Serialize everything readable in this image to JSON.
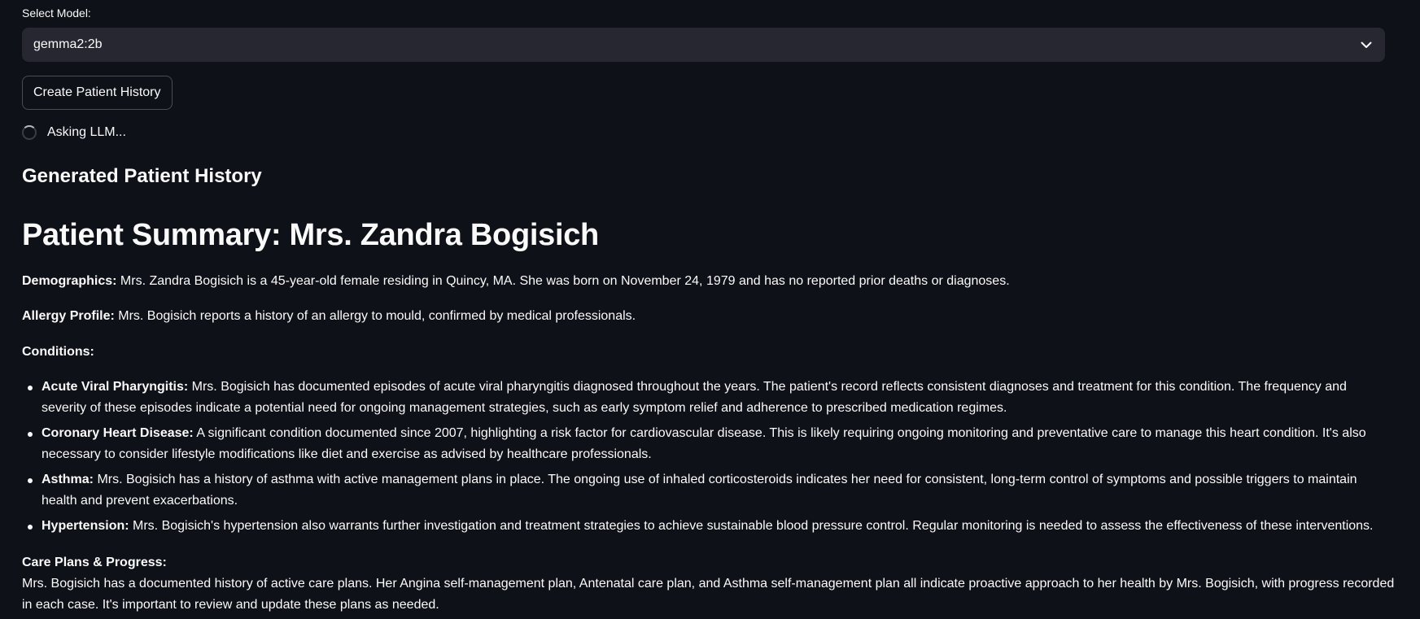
{
  "model_select": {
    "label": "Select Model:",
    "value": "gemma2:2b"
  },
  "create_button": {
    "label": "Create Patient History"
  },
  "status": {
    "text": "Asking LLM..."
  },
  "section_heading": "Generated Patient History",
  "summary": {
    "title": "Patient Summary: Mrs. Zandra Bogisich",
    "demographics": {
      "label": "Demographics:",
      "text": " Mrs. Zandra Bogisich is a 45-year-old female residing in Quincy, MA. She was born on November 24, 1979 and has no reported prior deaths or diagnoses."
    },
    "allergy": {
      "label": "Allergy Profile:",
      "text": " Mrs. Bogisich reports a history of an allergy to mould, confirmed by medical professionals."
    },
    "conditions_label": "Conditions:",
    "conditions": [
      {
        "name": "Acute Viral Pharyngitis:",
        "text": " Mrs. Bogisich has documented episodes of acute viral pharyngitis diagnosed throughout the years. The patient's record reflects consistent diagnoses and treatment for this condition. The frequency and severity of these episodes indicate a potential need for ongoing management strategies, such as early symptom relief and adherence to prescribed medication regimes."
      },
      {
        "name": "Coronary Heart Disease:",
        "text": " A significant condition documented since 2007, highlighting a risk factor for cardiovascular disease. This is likely requiring ongoing monitoring and preventative care to manage this heart condition. It's also necessary to consider lifestyle modifications like diet and exercise as advised by healthcare professionals."
      },
      {
        "name": "Asthma:",
        "text": " Mrs. Bogisich has a history of asthma with active management plans in place. The ongoing use of inhaled corticosteroids indicates her need for consistent, long-term control of symptoms and possible triggers to maintain health and prevent exacerbations."
      },
      {
        "name": "Hypertension:",
        "text": " Mrs. Bogisich's hypertension also warrants further investigation and treatment strategies to achieve sustainable blood pressure control. Regular monitoring is needed to assess the effectiveness of these interventions."
      }
    ],
    "care_plans": {
      "label": "Care Plans & Progress:",
      "text": "Mrs. Bogisich has a documented history of active care plans. Her Angina self-management plan, Antenatal care plan, and Asthma self-management plan all indicate proactive approach to her health by Mrs. Bogisich, with progress recorded in each case. It's important to review and update these plans as needed."
    }
  }
}
